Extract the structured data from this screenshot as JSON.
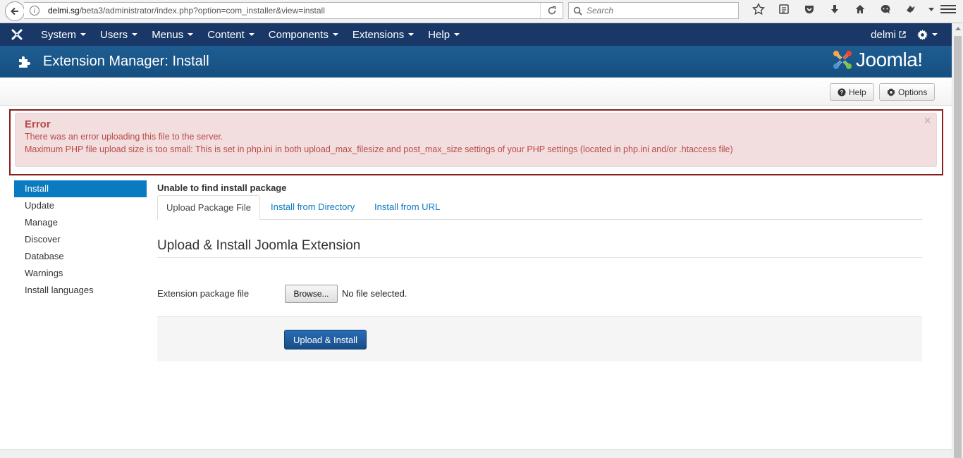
{
  "browser": {
    "url_domain": "delmi.sg",
    "url_path": "/beta3/administrator/index.php?option=com_installer&view=install",
    "search_placeholder": "Search"
  },
  "topnav": {
    "items": [
      {
        "label": "System"
      },
      {
        "label": "Users"
      },
      {
        "label": "Menus"
      },
      {
        "label": "Content"
      },
      {
        "label": "Components"
      },
      {
        "label": "Extensions"
      },
      {
        "label": "Help"
      }
    ],
    "user": "delmi"
  },
  "header": {
    "title": "Extension Manager: Install",
    "brand": "Joomla!"
  },
  "toolbar": {
    "help_label": "Help",
    "options_label": "Options"
  },
  "alert": {
    "heading": "Error",
    "line1": "There was an error uploading this file to the server.",
    "line2": "Maximum PHP file upload size is too small: This is set in php.ini in both upload_max_filesize and post_max_size settings of your PHP settings (located in php.ini and/or .htaccess file)",
    "close": "×"
  },
  "sidebar": {
    "items": [
      {
        "label": "Install"
      },
      {
        "label": "Update"
      },
      {
        "label": "Manage"
      },
      {
        "label": "Discover"
      },
      {
        "label": "Database"
      },
      {
        "label": "Warnings"
      },
      {
        "label": "Install languages"
      }
    ]
  },
  "main": {
    "subtitle": "Unable to find install package",
    "tabs": [
      {
        "label": "Upload Package File"
      },
      {
        "label": "Install from Directory"
      },
      {
        "label": "Install from URL"
      }
    ],
    "section_title": "Upload & Install Joomla Extension",
    "field_label": "Extension package file",
    "browse_label": "Browse...",
    "no_file": "No file selected.",
    "submit_label": "Upload & Install"
  },
  "colors": {
    "nav_bg": "#1a3867",
    "header_bg": "#17568c",
    "accent": "#0b7bc1",
    "error_text": "#b94a48",
    "error_bg": "#f2dede"
  }
}
